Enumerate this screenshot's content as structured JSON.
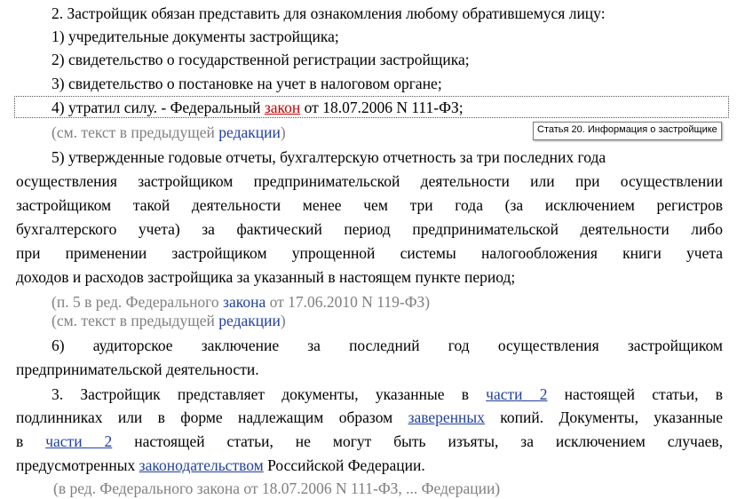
{
  "paragraphs": {
    "p2_intro": "2. Застройщик обязан представить для ознакомления любому обратившемуся лицу:",
    "item1": "1) учредительные документы застройщика;",
    "item2": "2) свидетельство о государственной регистрации застройщика;",
    "item3": "3) свидетельство о постановке на учет в налоговом органе;",
    "item4": {
      "before": "4) утратил силу. - Федеральный ",
      "link": "закон",
      "after": " от 18.07.2006 N 111-ФЗ;"
    },
    "note_prev1": {
      "before": "(см. текст в предыдущей ",
      "link": "редакции",
      "after": ")"
    },
    "item5_lines": [
      "5) утвержденные годовые отчеты, бухгалтерскую отчетность за три последних года",
      "осуществления застройщиком предпринимательской деятельности или при осуществлении",
      "застройщиком такой деятельности менее чем три года (за исключением регистров",
      "бухгалтерского учета) за фактический период предпринимательской деятельности либо",
      "при применении застройщиком упрощенной системы налогообложения книги учета",
      "доходов и расходов застройщика за указанный в настоящем пункте период;"
    ],
    "note_p5": {
      "before": "(п. 5 в ред. Федерального ",
      "link": "закона",
      "after": " от 17.06.2010 N 119-ФЗ)"
    },
    "note_prev2": {
      "before": "(см. текст в предыдущей ",
      "link": "редакции",
      "after": ")"
    },
    "item6_lines": [
      "6) аудиторское заключение за последний год осуществления застройщиком",
      "предпринимательской деятельности."
    ],
    "p3": {
      "l1_before": "3. Застройщик представляет документы, указанные в ",
      "l1_link": "части 2",
      "l1_after": " настоящей статьи, в",
      "l2_before": "подлинниках или в форме надлежащим образом ",
      "l2_link": "заверенных",
      "l2_after": " копий. Документы, указанные",
      "l3_before": "в ",
      "l3_link": "части 2",
      "l3_after": " настоящей статьи, не могут быть изъяты, за исключением случаев,",
      "l4_before": "предусмотренных ",
      "l4_link": "законодательством",
      "l4_after": " Российской Федерации."
    },
    "cutoff": "(в ред. Федерального закона от 18.07.2006 N 111-ФЗ, ... Федерации)"
  },
  "tooltip": "Статья 20. Информация о застройщике",
  "colors": {
    "link": "#1f3f9f",
    "link_red": "#c00000",
    "note_gray": "#7f7f7f"
  }
}
